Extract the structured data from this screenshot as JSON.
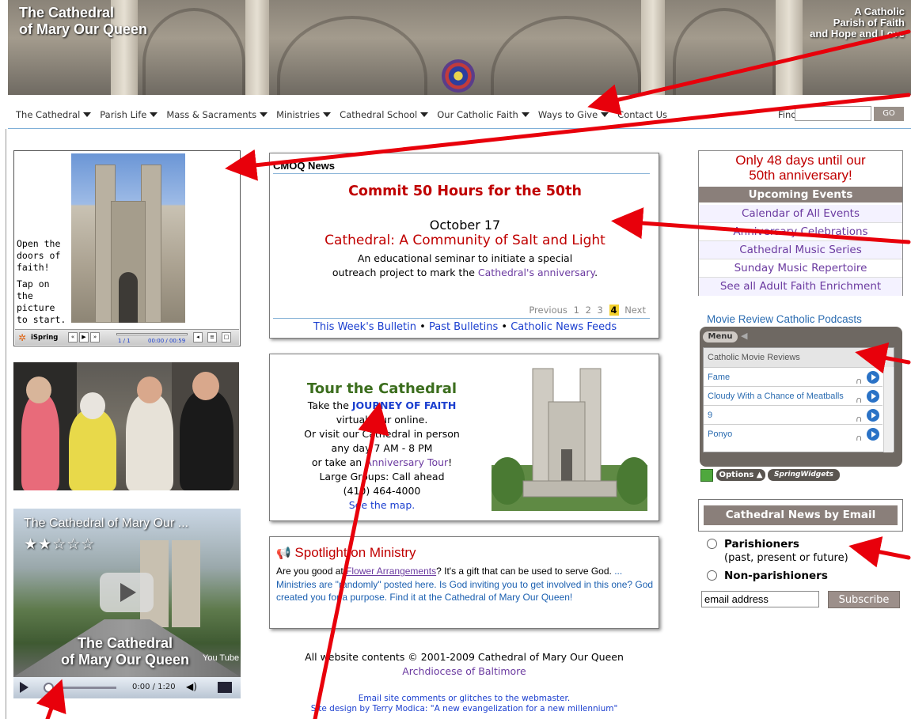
{
  "header": {
    "site_title_line1": "The Cathedral",
    "site_title_line2": "of Mary Our Queen",
    "tagline_line1": "A Catholic",
    "tagline_line2": "Parish of Faith",
    "tagline_line3": "and Hope and Love"
  },
  "nav": {
    "items": [
      {
        "label": "The Cathedral"
      },
      {
        "label": "Parish Life"
      },
      {
        "label": "Mass & Sacraments"
      },
      {
        "label": "Ministries"
      },
      {
        "label": "Cathedral School"
      },
      {
        "label": "Our Catholic Faith"
      },
      {
        "label": "Ways to Give"
      },
      {
        "label": "Contact Us"
      }
    ],
    "find_label": "Find:",
    "go_label": "GO"
  },
  "ispring": {
    "text_line1": "Open the",
    "text_line2": "doors of",
    "text_line3": "faith!",
    "text_line4": "Tap on the",
    "text_line5": "picture",
    "text_line6": "to start.",
    "brand": "iSpring",
    "slide_counter": "1 / 1",
    "time": "00:00 / 00:59"
  },
  "youtube": {
    "title": "The Cathedral of Mary Our ...",
    "stars": "★★☆☆☆",
    "caption_line1": "The Cathedral",
    "caption_line2": "of Mary Our Queen",
    "logo": "You Tube",
    "time": "0:00 / 1:20"
  },
  "news": {
    "heading": "CMOQ News",
    "title": "Commit 50 Hours for the 50th",
    "date": "October 17",
    "subtitle": "Cathedral: A Community of Salt and Light",
    "body_line1": "An educational seminar to initiate a special",
    "body_line2_prefix": "outreach project to mark the ",
    "body_line2_link": "Cathedral's anniversary",
    "body_line2_suffix": ".",
    "pager_prev": "Previous",
    "pager_pages": [
      "1",
      "2",
      "3"
    ],
    "pager_current": "4",
    "pager_next": "Next",
    "link_bulletin": "This Week's Bulletin",
    "link_past": "Past Bulletins",
    "link_feeds": "Catholic News Feeds",
    "separator": "•"
  },
  "tour": {
    "title": "Tour the Cathedral",
    "line1_prefix": "Take the ",
    "line1_link": "JOURNEY OF FAITH",
    "line2": "virtual tour online.",
    "line3": "Or visit our Cathedral in person",
    "line4": "any day 7 AM - 8 PM",
    "line5_prefix": "or take an ",
    "line5_link": "Anniversary Tour",
    "line5_suffix": "!",
    "line6": "Large Groups: Call ahead",
    "line7": "(410) 464-4000",
    "line8": "See the map."
  },
  "spotlight": {
    "title": "Spotlight on Ministry",
    "prefix": "Are you good at ",
    "link": "Flower Arrangements",
    "text1": "? It's a gift that can be used to serve God. ",
    "text2": "... Ministries are \"randomly\" posted here. Is God inviting you to get involved in this one? God created you for a purpose. Find it at the Cathedral of Mary Our Queen!"
  },
  "footer": {
    "copyright": "All website contents © 2001-2009 Cathedral of Mary Our Queen",
    "archdiocese": "Archdiocese of Baltimore",
    "comments": "Email site comments or glitches to the webmaster.",
    "design": "Site design by Terry Modica: \"A new evangelization for a new millennium\""
  },
  "events": {
    "countdown_line1": "Only 48 days until our",
    "countdown_line2": "50th anniversary!",
    "heading": "Upcoming Events",
    "items": [
      {
        "label": "Calendar of All Events"
      },
      {
        "label": "Anniversary Celebrations"
      },
      {
        "label": "Cathedral Music Series"
      },
      {
        "label": "Sunday Music Repertoire"
      },
      {
        "label": "See all Adult Faith Enrichment"
      }
    ]
  },
  "podcasts": {
    "heading": "Movie Review Catholic Podcasts",
    "menu": "Menu",
    "category": "Catholic Movie Reviews",
    "items": [
      {
        "label": "Fame"
      },
      {
        "label": "Cloudy With a Chance of Meatballs"
      },
      {
        "label": "9"
      },
      {
        "label": "Ponyo"
      }
    ],
    "options": "Options ▲",
    "spring_widgets": "SpringWidgets"
  },
  "email_signup": {
    "heading": "Cathedral News by Email",
    "option1": "Parishioners",
    "option1_sub": "(past, present or future)",
    "option2": "Non-parishioners",
    "input_value": "email address",
    "subscribe": "Subscribe"
  },
  "colors": {
    "annotation_red": "#e8000b",
    "news_red": "#c00000",
    "link_blue": "#1a3ecf",
    "link_purple": "#6b3aa0",
    "taupe": "#8a7f7a"
  }
}
